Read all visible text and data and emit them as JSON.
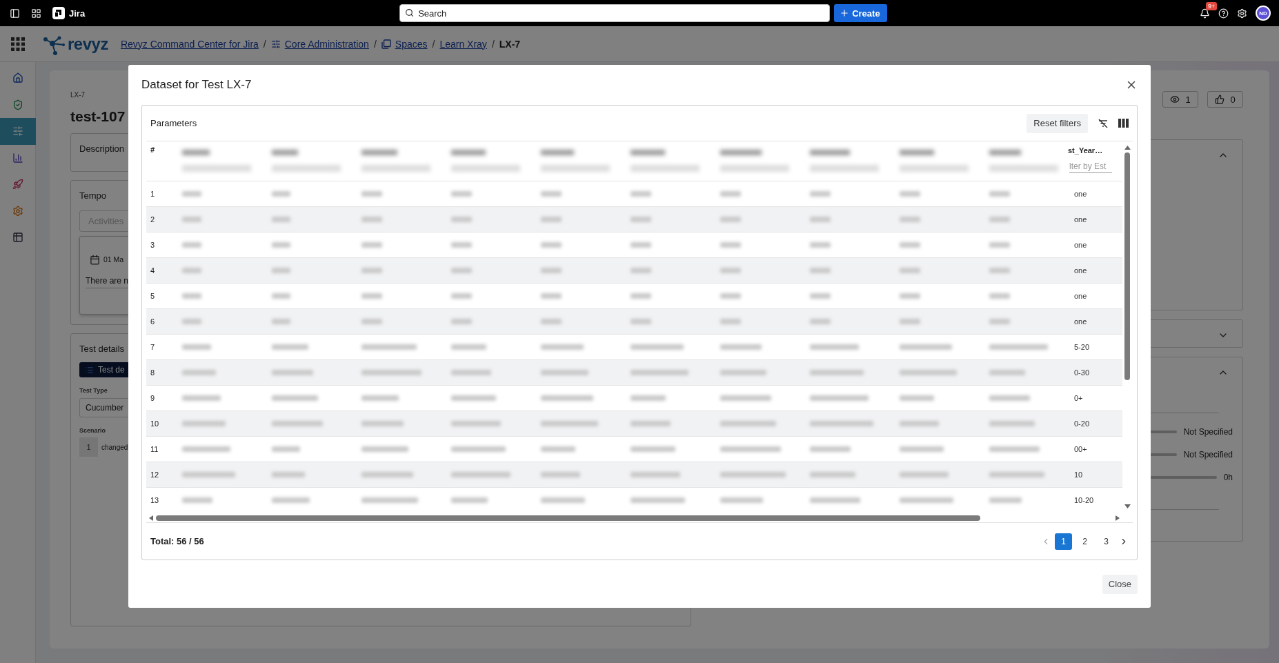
{
  "topbar": {
    "app_name": "Jira",
    "search_placeholder": "Search",
    "create_label": "Create",
    "notification_badge": "9+",
    "avatar_initials": "ND"
  },
  "breadcrumb": {
    "logo_text": "revyz",
    "separator": "/",
    "items": [
      {
        "label": "Revyz Command Center for Jira",
        "kind": "link"
      },
      {
        "label": "Core Administration",
        "kind": "sliders_link"
      },
      {
        "label": "Spaces",
        "kind": "spaces_link"
      },
      {
        "label": "Learn Xray",
        "kind": "link"
      },
      {
        "label": "LX-7",
        "kind": "current"
      }
    ]
  },
  "sidebar": {
    "items": [
      {
        "kind": "home",
        "selected": false
      },
      {
        "kind": "shield",
        "selected": false
      },
      {
        "kind": "sliders",
        "selected": true
      },
      {
        "kind": "chart",
        "selected": false
      },
      {
        "kind": "rocket",
        "selected": false
      },
      {
        "kind": "gear",
        "selected": false
      },
      {
        "kind": "table",
        "selected": false
      }
    ]
  },
  "issue": {
    "key": "LX-7",
    "title": "test-107",
    "description_label": "Description",
    "tempo_label": "Tempo",
    "activities_tab": "Activities",
    "date": "01 Ma",
    "worklog_text": "There are n",
    "test_details_label": "Test details",
    "test_details_button": "Test de",
    "test_type_label": "Test Type",
    "test_type_value": "Cucumber",
    "scenario_label": "Scenario",
    "scenario_line_number": "1",
    "scenario_text": "changed"
  },
  "side_panel": {
    "watchers": "1",
    "votes": "0",
    "panels": [
      {
        "expanded": true
      },
      {
        "expanded": false
      },
      {
        "expanded": true,
        "readings": [
          "Not Specified",
          "Not Specified",
          "0h"
        ]
      }
    ]
  },
  "modal": {
    "title": "Dataset for Test LX-7",
    "panel_title": "Parameters",
    "reset_filters": "Reset filters",
    "close_label": "Close",
    "total": "Total: 56 / 56",
    "table": {
      "number_header": "#",
      "last_column_header": "st_Year…",
      "last_column_filter_placeholder": "lter by Est",
      "rows": [
        {
          "number": "1",
          "last_value": "one"
        },
        {
          "number": "2",
          "last_value": "one"
        },
        {
          "number": "3",
          "last_value": "one"
        },
        {
          "number": "4",
          "last_value": "one"
        },
        {
          "number": "5",
          "last_value": "one"
        },
        {
          "number": "6",
          "last_value": "one"
        },
        {
          "number": "7",
          "last_value": "5-20"
        },
        {
          "number": "8",
          "last_value": "0-30"
        },
        {
          "number": "9",
          "last_value": "0+"
        },
        {
          "number": "10",
          "last_value": "0-20"
        },
        {
          "number": "11",
          "last_value": "00+"
        },
        {
          "number": "12",
          "last_value": "10"
        },
        {
          "number": "13",
          "last_value": "10-20"
        }
      ]
    },
    "pages": [
      {
        "label": "1",
        "selected": true
      },
      {
        "label": "2",
        "selected": false
      },
      {
        "label": "3",
        "selected": false
      }
    ]
  }
}
